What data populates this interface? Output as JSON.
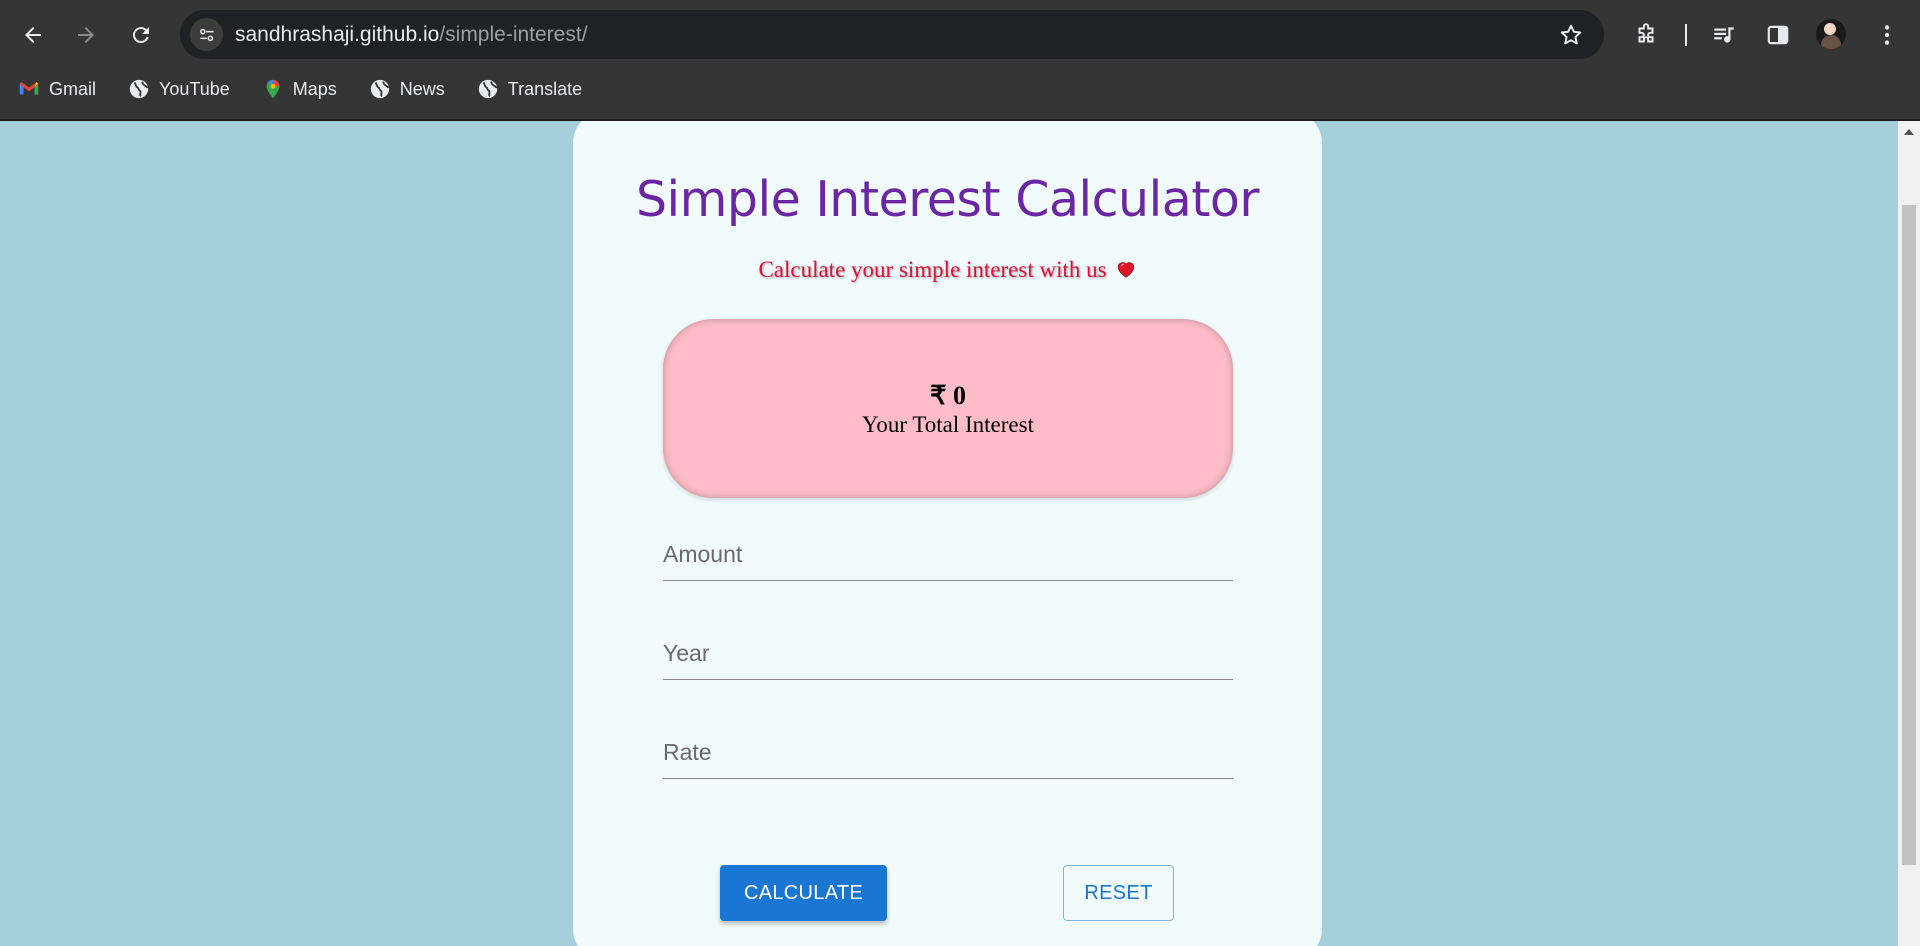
{
  "browser": {
    "url_domain": "sandhrashaji.github.io",
    "url_path": "/simple-interest/",
    "bookmarks": [
      {
        "label": "Gmail",
        "icon": "gmail-icon"
      },
      {
        "label": "YouTube",
        "icon": "globe-icon"
      },
      {
        "label": "Maps",
        "icon": "maps-icon"
      },
      {
        "label": "News",
        "icon": "globe-icon"
      },
      {
        "label": "Translate",
        "icon": "globe-icon"
      }
    ]
  },
  "page": {
    "title": "Simple Interest Calculator",
    "subtitle": "Calculate your simple interest with us",
    "result": {
      "amount": "₹ 0",
      "label": "Your Total Interest"
    },
    "fields": {
      "amount_placeholder": "Amount",
      "year_placeholder": "Year",
      "rate_placeholder": "Rate"
    },
    "buttons": {
      "calculate": "CALCULATE",
      "reset": "RESET"
    }
  },
  "colors": {
    "page_background": "#a6cfdc",
    "card_background": "#f1fbfc",
    "title": "#6a26a3",
    "subtitle": "#e0103a",
    "result_box": "#fdbcc8",
    "primary_button": "#1976d2"
  }
}
